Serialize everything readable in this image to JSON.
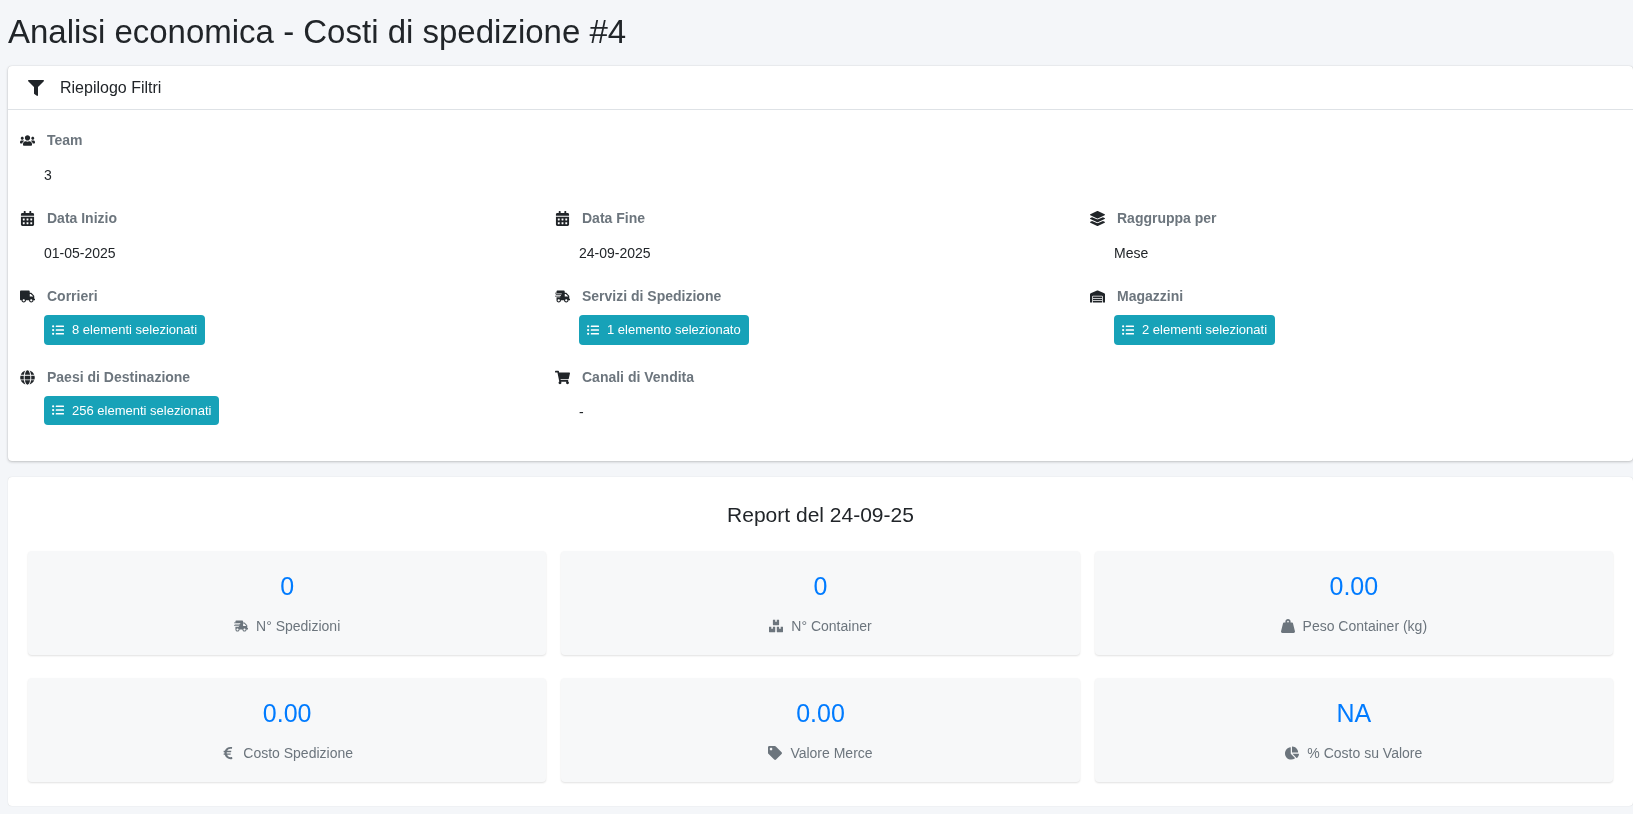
{
  "page_title": "Analisi economica - Costi di spedizione #4",
  "filters": {
    "title": "Riepilogo Filtri",
    "rows": [
      [
        {
          "label": "Team",
          "kind": "value",
          "value": "3"
        }
      ],
      [
        {
          "label": "Data Inizio",
          "kind": "value",
          "value": "01-05-2025"
        },
        {
          "label": "Data Fine",
          "kind": "value",
          "value": "24-09-2025"
        },
        {
          "label": "Raggruppa per",
          "kind": "value",
          "value": "Mese"
        }
      ],
      [
        {
          "label": "Corrieri",
          "kind": "selection",
          "value": "8 elementi selezionati"
        },
        {
          "label": "Servizi di Spedizione",
          "kind": "selection",
          "value": "1 elemento selezionato"
        },
        {
          "label": "Magazzini",
          "kind": "selection",
          "value": "2 elementi selezionati"
        }
      ],
      [
        {
          "label": "Paesi di Destinazione",
          "kind": "selection",
          "value": "256 elementi selezionati"
        },
        {
          "label": "Canali di Vendita",
          "kind": "value",
          "value": "-"
        }
      ]
    ]
  },
  "report": {
    "title": "Report del 24-09-25",
    "stats": [
      {
        "value": "0",
        "label": "N° Spedizioni"
      },
      {
        "value": "0",
        "label": "N° Container"
      },
      {
        "value": "0.00",
        "label": "Peso Container (kg)"
      },
      {
        "value": "0.00",
        "label": "Costo Spedizione"
      },
      {
        "value": "0.00",
        "label": "Valore Merce"
      },
      {
        "value": "NA",
        "label": "% Costo su Valore"
      }
    ]
  }
}
